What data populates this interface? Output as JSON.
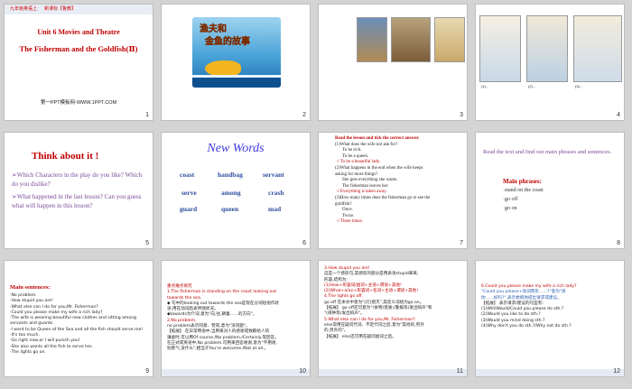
{
  "slide_numbers": [
    "1",
    "2",
    "3",
    "4",
    "5",
    "6",
    "7",
    "8",
    "9",
    "10",
    "11",
    "12"
  ],
  "slide1": {
    "header_left": "九年级英语上",
    "header_mid": "新课标【鲁教】",
    "unit_title": "Unit 6 Movies and Theatre",
    "lesson_title": "The Fisherman and the Goldfish(Ⅱ)",
    "url": "第一PPT模板网-WWW.1PPT.COM"
  },
  "slide2": {
    "pic_title_1": "渔夫和",
    "pic_title_2": "金鱼的故事"
  },
  "slide5": {
    "title": "Think about it !",
    "q1": "➢Which Characters in the play do you like? Which do you dislike?",
    "q2": "➢What happened in the last lesson? Can you guess what will happen in this lesson?"
  },
  "slide6": {
    "title": "New Words",
    "words": [
      "coast",
      "handbag",
      "servant",
      "serve",
      "among",
      "crash",
      "guard",
      "queen",
      "mad"
    ]
  },
  "slide7": {
    "lines": [
      "Read the lesson and tick the correct answer.",
      "(1)What does the wife not ask for?",
      "To be rich.",
      "To be a queen.",
      "√  To be a beautiful lady.",
      "(2)What happens in the end when the wife keeps",
      "asking for more things?",
      "She gets everything she wants.",
      "The fisherman leaves her.",
      "√  Everything is taken away.",
      "(3)How many times does the fisherman go to see the",
      "goldfish?",
      "Once.",
      "Twice.",
      "√  Three times."
    ]
  },
  "slide8": {
    "instruction": "Read the text and find out main phrases and sentences.",
    "heading": "Main phrases:",
    "phrases": [
      "·stand on the coast",
      "·go off",
      "·go on"
    ]
  },
  "slide9": {
    "heading": "Main sentences:",
    "lines": [
      "·No problem.",
      "·How stupid you are!",
      "·What else can I do for you,Mr. Fisherman?",
      "·Could you please make my wife a rich lady?",
      "·The wife is wearing beautiful new clothes and sitting among",
      "servants and guards.",
      "·I want to be Queen of the Sea and all the fish should serve me!",
      "·It's too much.",
      "·Go right now,or I will punish you!",
      "·She also wants all the fish to serve her.",
      "·The lights go on."
    ]
  },
  "slide10": {
    "lines": [
      "重点难点探究",
      "1.The fisherman is standing on the coast looking out",
      "towards the sea.",
      "◆ 句中的looking out towards the sea是现在分词短语作状",
      "语,用在动词后表伴随状况。",
      "◆towards为介词,意为\"向,往,朝着……的方向\"。",
      "2.No problem.",
      "no problem表示同意、赞同,意为\"没问题\"。",
      "【拓展】 在日常用语中,当用来对人的感谢或致歉给人的",
      "谦虚时,可以用Of course./No problem./Certainly.等回答。",
      "在正式或英语中,No problem.可用来回答谢谢,意为\"不用谢,",
      "别客气,没什么\",相当于You're welcome./Not at all.。"
    ]
  },
  "slide11": {
    "lines": [
      "3.How stupid you are!",
      "这是一个感叹句,其感叹的部分是用表语stupid来来,",
      "形容,结构为:",
      "(1)How+形容词/副词+主语+谓语+其他!",
      "(2)What+a/an+形容词+名词+主语+谓语+其他!",
      "4.The lights go off.",
      "go off 在本文中意为\"(灯)熄灭\",其反义词组为go on。",
      "【拓展】 go off还可意为\"(食物)变质;(警报等)发出响声\"和",
      "\"(闹钟等)发出响声\"。",
      "5.What else can I do for you,Mr. Fisherman?",
      "else常用在疑问代词、不定代词之后,意为\"其他的,另外",
      "的,另外的\"。",
      "【拓展】 else还可用在疑问副词之后。"
    ]
  },
  "slide12": {
    "lines": [
      "6.Could you please make my wife a rich lady?",
      "\"Could you please+动词原形……?\"意为\"请",
      "你……好吗?\",表示委婉地提出请求或建议。",
      "【拓展】 表示请求/建议的句型有:",
      "(1)Will/Would/Could you please do sth.?",
      "(2)Would you like to do sth.?",
      "(3)Would you mind doing sth.?",
      "(4)Why don't you do sth.?/Why not do sth.?"
    ]
  },
  "slide4": {
    "cap1": "(1)...",
    "cap2": "(2)...",
    "cap3": "(3)..."
  }
}
